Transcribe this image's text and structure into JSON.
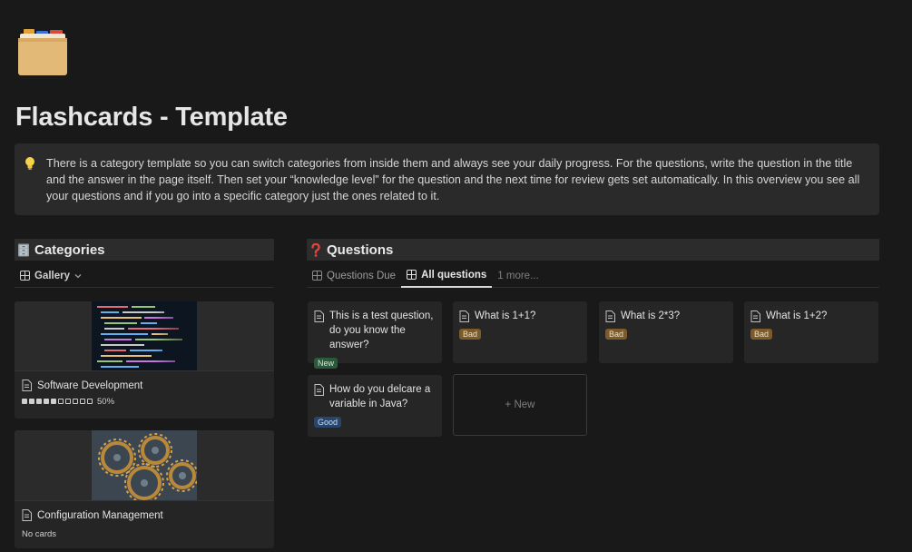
{
  "page": {
    "title": "Flashcards - Template",
    "icon": "card-index-folder-icon"
  },
  "callout": {
    "icon": "lightbulb-icon",
    "text": "There is a category template so you can switch categories from inside them and always see your daily progress. For the questions, write the question in the title and the answer in the page itself. Then set your “knowledge level” for the question and the next time for review gets set automatically. In this overview you see all your questions and if you go into a specific category just the ones related to it."
  },
  "categories": {
    "title": "Categories",
    "icon": "file-cabinet-icon",
    "view": {
      "label": "Gallery",
      "icon": "gallery-icon"
    },
    "cards": [
      {
        "title": "Software Development",
        "progress_text": "50%",
        "progress": 0.5,
        "cover": "code-screen-image"
      },
      {
        "title": "Configuration Management",
        "status": "No cards",
        "cover": "gears-image"
      }
    ]
  },
  "questions": {
    "title": "Questions",
    "icon": "question-mark-icon",
    "tabs": [
      {
        "label": "Questions Due",
        "active": false
      },
      {
        "label": "All questions",
        "active": true
      },
      {
        "label": "1 more...",
        "active": false
      }
    ],
    "cards": [
      {
        "title": "This is a test question, do you know the answer?",
        "tag": "New"
      },
      {
        "title": "What is 1+1?",
        "tag": "Bad"
      },
      {
        "title": "What is 2*3?",
        "tag": "Bad"
      },
      {
        "title": "What is 1+2?",
        "tag": "Bad"
      },
      {
        "title": "How do you delcare a variable in Java?",
        "tag": "Good"
      }
    ],
    "new_label": "+ New"
  },
  "colors": {
    "background": "#191919",
    "tag_new": "#2b5a3a",
    "tag_bad": "#7b5a2c",
    "tag_good": "#28456c"
  }
}
